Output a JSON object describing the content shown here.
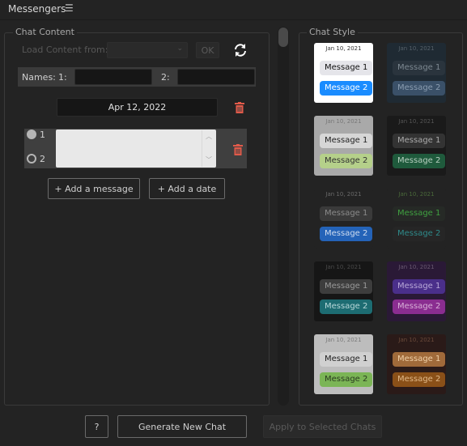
{
  "app": {
    "title": "Messengers",
    "menu_icon": "hamburger-icon"
  },
  "chat_content": {
    "legend": "Chat Content",
    "load_label": "Load Content from:",
    "load_select_value": "",
    "ok_label": "OK",
    "names_label": "Names:",
    "name1_label": "1:",
    "name1_value": "",
    "name2_label": "2:",
    "name2_value": "",
    "date_value": "Apr 12, 2022",
    "message_sender1_label": "1",
    "message_sender2_label": "2",
    "message_text": "",
    "add_message_label": "+ Add a message",
    "add_date_label": "+ Add a date"
  },
  "chat_style": {
    "legend": "Chat Style",
    "styles": [
      {
        "date": "Jan 10, 2021",
        "msg1": "Message 1",
        "msg2": "Message 2",
        "bg": "#ffffff",
        "date_color": "#333333",
        "b1_bg": "#e5e5ea",
        "b1_fg": "#111111",
        "b2_bg": "#1a8cff",
        "b2_fg": "#ffffff"
      },
      {
        "date": "Jan 10, 2021",
        "msg1": "Message 1",
        "msg2": "Message 2",
        "bg": "#1f2a33",
        "date_color": "#56616a",
        "b1_bg": "#2a343d",
        "b1_fg": "#7d8891",
        "b2_bg": "#3a5068",
        "b2_fg": "#8a9cb0"
      },
      {
        "date": "Jan 10, 2021",
        "msg1": "Message 1",
        "msg2": "Message 2",
        "bg": "#a9a9a9",
        "date_color": "#777777",
        "b1_bg": "#d6d6d6",
        "b1_fg": "#222222",
        "b2_bg": "#b5d08a",
        "b2_fg": "#333333"
      },
      {
        "date": "Jan 10, 2021",
        "msg1": "Message 1",
        "msg2": "Message 2",
        "bg": "#1a1a1a",
        "date_color": "#555555",
        "b1_bg": "#333333",
        "b1_fg": "#aaaaaa",
        "b2_bg": "#1f5a3c",
        "b2_fg": "#b8cfc0"
      },
      {
        "date": "Jan 10, 2021",
        "msg1": "Message 1",
        "msg2": "Message 2",
        "bg": "#232323",
        "date_color": "#6a6a6a",
        "b1_bg": "#3a3a3a",
        "b1_fg": "#8a8a8a",
        "b2_bg": "#2463b8",
        "b2_fg": "#cfdcef"
      },
      {
        "date": "Jan 10, 2021",
        "msg1": "Message 1",
        "msg2": "Message 2",
        "bg": "#232323",
        "date_color": "#4a6a3a",
        "b1_bg": "#262a26",
        "b1_fg": "#3fa040",
        "b2_bg": "#262626",
        "b2_fg": "#2e8a8a"
      },
      {
        "date": "Jan 10, 2021",
        "msg1": "Message 1",
        "msg2": "Message 2",
        "bg": "#161616",
        "date_color": "#4a4a4a",
        "b1_bg": "#3d3d3d",
        "b1_fg": "#999999",
        "b2_bg": "#1d6c72",
        "b2_fg": "#b8d8da"
      },
      {
        "date": "Jan 10, 2021",
        "msg1": "Message 1",
        "msg2": "Message 2",
        "bg": "#2a1936",
        "date_color": "#6a5a72",
        "b1_bg": "#4a2f8a",
        "b1_fg": "#b8a8d8",
        "b2_bg": "#8a2d90",
        "b2_fg": "#d8b0d8"
      },
      {
        "date": "Jan 10, 2021",
        "msg1": "Message 1",
        "msg2": "Message 2",
        "bg": "#bdbdbd",
        "date_color": "#7a7a7a",
        "b1_bg": "#d0d0d0",
        "b1_fg": "#222222",
        "b2_bg": "#7bb556",
        "b2_fg": "#2a3a20"
      },
      {
        "date": "Jan 10, 2021",
        "msg1": "Message 1",
        "msg2": "Message 2",
        "bg": "#2a1a18",
        "date_color": "#6a4a3a",
        "b1_bg": "#a06a3a",
        "b1_fg": "#f0d0a8",
        "b2_bg": "#8a5018",
        "b2_fg": "#e0b888"
      }
    ]
  },
  "footer": {
    "help_label": "?",
    "generate_label": "Generate New Chat",
    "apply_label": "Apply to Selected Chats"
  },
  "colors": {
    "accent_red": "#e05a4a",
    "panel_bg": "#232323"
  }
}
